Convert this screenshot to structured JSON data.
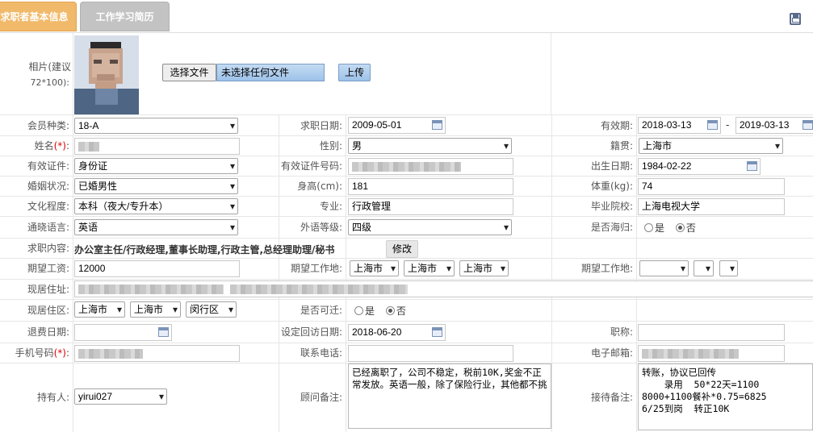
{
  "tabs": [
    {
      "label": "求职者基本信息"
    },
    {
      "label": "工作学习简历"
    }
  ],
  "photo": {
    "label": "相片(建议",
    "label2": "72*100):",
    "choose_button": "选择文件",
    "no_file": "未选择任何文件",
    "upload_button": "上传"
  },
  "row1": {
    "member_type_label": "会员种类:",
    "member_type": "18-A",
    "job_date_label": "求职日期:",
    "job_date": "2009-05-01",
    "valid_label": "有效期:",
    "valid_from": "2018-03-13",
    "dash": "-",
    "valid_to": "2019-03-13"
  },
  "row2": {
    "name_label": "姓名",
    "name_req": "(*)",
    "name_colon": ":",
    "gender_label": "性别:",
    "gender": "男",
    "native_label": "籍贯:",
    "native": "上海市"
  },
  "row3": {
    "id_type_label": "有效证件:",
    "id_type": "身份证",
    "id_no_label": "有效证件号码:",
    "birth_label": "出生日期:",
    "birth": "1984-02-22"
  },
  "row4": {
    "marital_label": "婚姻状况:",
    "marital": "已婚男性",
    "height_label": "身高(cm):",
    "height": "181",
    "weight_label": "体重(kg):",
    "weight": "74"
  },
  "row5": {
    "edu_label": "文化程度:",
    "edu": "本科（夜大/专升本）",
    "major_label": "专业:",
    "major": "行政管理",
    "school_label": "毕业院校:",
    "school": "上海电视大学"
  },
  "row6": {
    "lang_label": "通晓语言:",
    "lang": "英语",
    "lang_level_label": "外语等级:",
    "lang_level": "四级",
    "overseas_label": "是否海归:",
    "yes": "是",
    "no": "否"
  },
  "row7": {
    "intent_label": "求职内容:",
    "intent": "办公室主任/行政经理,董事长助理,行政主管,总经理助理/秘书",
    "edit_button": "修改"
  },
  "row8": {
    "salary_label": "期望工资:",
    "salary": "12000",
    "workplace_label": "期望工作地:",
    "wp1": "上海市",
    "wp2": "上海市",
    "wp3": "上海市",
    "workplace2_label": "期望工作地:"
  },
  "row9": {
    "address_label": "现居住址:"
  },
  "row10": {
    "area_label": "现居住区:",
    "area1": "上海市",
    "area2": "上海市",
    "area3": "闵行区",
    "relocate_label": "是否可迁:",
    "yes": "是",
    "no": "否"
  },
  "row11": {
    "refund_label": "退费日期:",
    "revisit_label": "设定回访日期:",
    "revisit": "2018-06-20",
    "title_label": "职称:"
  },
  "row12": {
    "mobile_label": "手机号码",
    "mobile_req": "(*)",
    "mobile_colon": ":",
    "phone_label": "联系电话:",
    "email_label": "电子邮箱:"
  },
  "row13": {
    "owner_label": "持有人:",
    "owner": "yirui027",
    "consultant_note_label": "顾问备注:",
    "consultant_note": "已经离职了，公司不稳定，税前10K,奖金不正常发放。英语一般，除了保险行业，其他都不挑",
    "reception_note_label": "接待备注:",
    "reception_note": "转账，协议已回传\n    录用  50*22天=1100\n8000+1100餐补*0.75=6825\n6/25到岗  转正10K"
  }
}
